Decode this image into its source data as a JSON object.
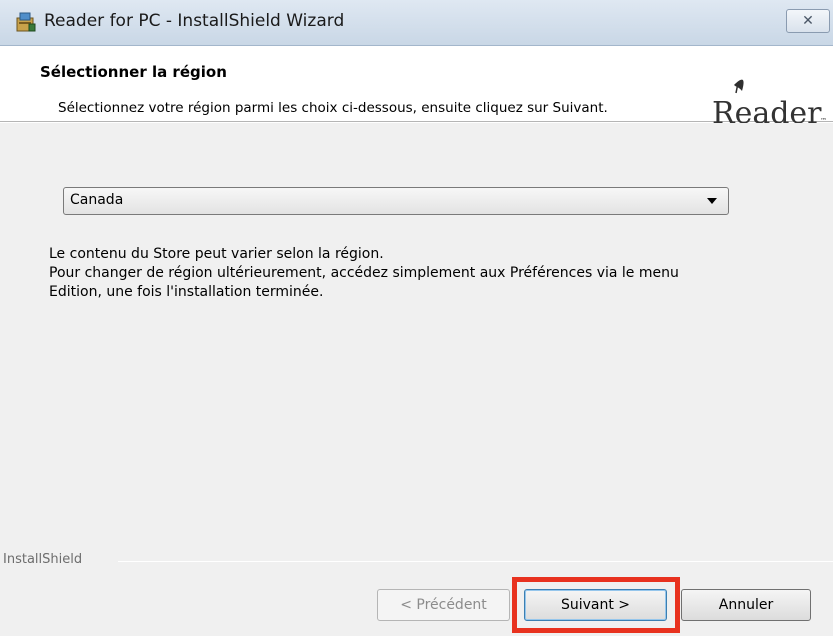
{
  "window": {
    "title": "Reader for PC - InstallShield Wizard",
    "close_label": "✕"
  },
  "header": {
    "title": "Sélectionner la région",
    "subtitle": "Sélectionnez votre région parmi les choix ci-dessous, ensuite cliquez sur Suivant.",
    "logo_text": "Reader",
    "logo_color": "#333333"
  },
  "region": {
    "selected": "Canada"
  },
  "info": {
    "lines": [
      "Le contenu du Store peut varier selon la région.",
      "Pour changer de région ultérieurement, accédez simplement aux Préférences via le menu",
      "Edition, une fois l'installation terminée."
    ]
  },
  "footer": {
    "brand": "InstallShield",
    "prev_label": "< Précédent",
    "next_label": "Suivant >",
    "cancel_label": "Annuler"
  },
  "colors": {
    "highlight": "#e8321f",
    "content_bg": "#f0f0f0"
  }
}
